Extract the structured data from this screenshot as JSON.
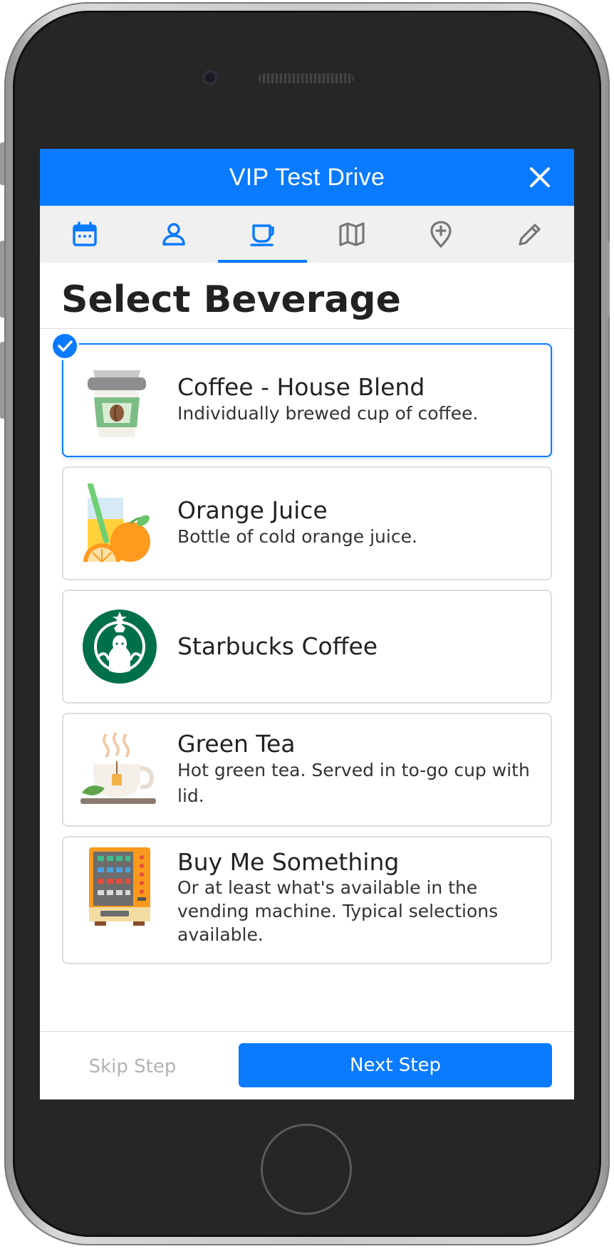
{
  "app": {
    "title": "VIP Test Drive",
    "close_icon": "close-icon"
  },
  "tabs": [
    {
      "icon": "calendar-icon",
      "active": false
    },
    {
      "icon": "person-icon",
      "active": false
    },
    {
      "icon": "coffee-cup-icon",
      "active": true
    },
    {
      "icon": "map-icon",
      "active": false
    },
    {
      "icon": "location-add-icon",
      "active": false
    },
    {
      "icon": "pencil-icon",
      "active": false
    }
  ],
  "page": {
    "title": "Select Beverage"
  },
  "beverages": [
    {
      "name": "Coffee - House Blend",
      "description": "Individually brewed cup of coffee.",
      "icon": "coffee-cup-image",
      "selected": true
    },
    {
      "name": "Orange Juice",
      "description": "Bottle of cold orange juice.",
      "icon": "orange-juice-image",
      "selected": false
    },
    {
      "name": "Starbucks Coffee",
      "description": "",
      "icon": "starbucks-logo",
      "selected": false
    },
    {
      "name": "Green Tea",
      "description": "Hot green tea. Served in to-go cup with lid.",
      "icon": "tea-cup-image",
      "selected": false
    },
    {
      "name": "Buy Me Something",
      "description": "Or at least what's available in the vending machine. Typical selections available.",
      "icon": "vending-machine-image",
      "selected": false
    }
  ],
  "footer": {
    "skip_label": "Skip Step",
    "next_label": "Next Step"
  },
  "colors": {
    "accent": "#0a7aff",
    "tab_bar": "#f0f0f0",
    "inactive_icon": "#777777"
  }
}
